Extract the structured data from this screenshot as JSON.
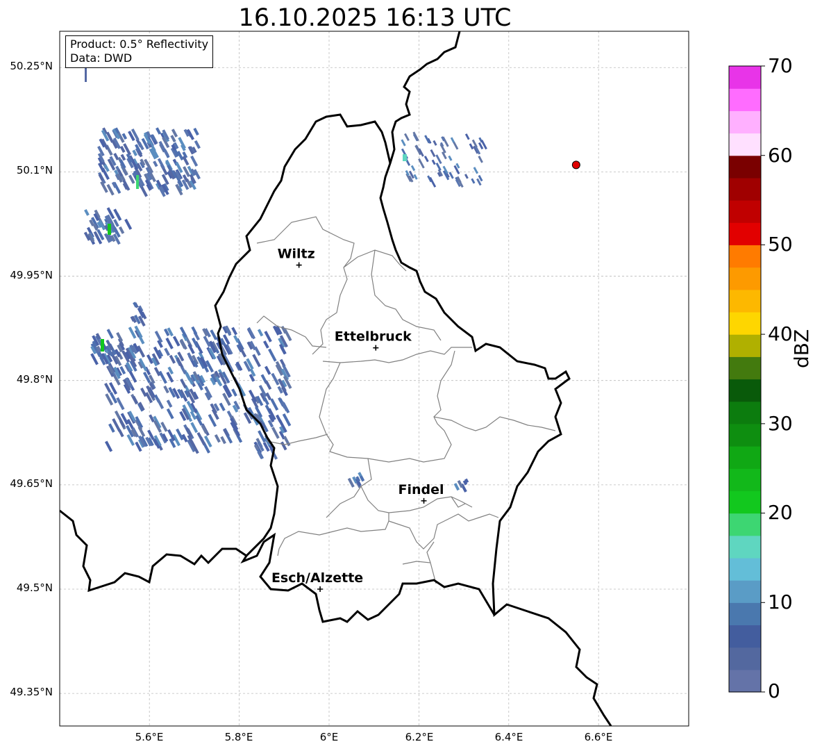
{
  "title": "16.10.2025 16:13 UTC",
  "info_box": {
    "product": "Product: 0.5° Reflectivity",
    "data": "Data: DWD"
  },
  "map": {
    "lat_ticks": [
      "50.25°N",
      "50.1°N",
      "49.95°N",
      "49.8°N",
      "49.65°N",
      "49.5°N",
      "49.35°N"
    ],
    "lon_ticks": [
      "5.6°E",
      "5.8°E",
      "6°E",
      "6.2°E",
      "6.4°E",
      "6.6°E"
    ],
    "cities": [
      {
        "name": "Wiltz",
        "lon": 5.933,
        "lat": 49.966
      },
      {
        "name": "Ettelbruck",
        "lon": 6.104,
        "lat": 49.847
      },
      {
        "name": "Findel",
        "lon": 6.211,
        "lat": 49.627
      },
      {
        "name": "Esch/Alzette",
        "lon": 5.98,
        "lat": 49.5
      }
    ],
    "marker": {
      "lon": 6.55,
      "lat": 50.11,
      "color": "#e00000"
    },
    "colors": {
      "border": "#000000",
      "districts": "#808080",
      "grid": "#bbbbbb"
    }
  },
  "colorbar": {
    "label": "dBZ",
    "ticks": [
      "0",
      "10",
      "20",
      "30",
      "40",
      "50",
      "60",
      "70"
    ],
    "range": [
      0,
      70
    ],
    "colors": [
      "#6473a8",
      "#53689f",
      "#435d9e",
      "#4a78ae",
      "#5a9cc6",
      "#63bed8",
      "#5fd6c0",
      "#3dd672",
      "#12c81e",
      "#12b81a",
      "#10a814",
      "#0e8e10",
      "#0c7c0e",
      "#095a0a",
      "#437a0e",
      "#b0b000",
      "#fed600",
      "#fdb800",
      "#fd9a00",
      "#ff7b00",
      "#e20000",
      "#c00000",
      "#a00000",
      "#7a0000",
      "#ffe0ff",
      "#ffb0ff",
      "#ff6cff",
      "#e834e8"
    ]
  }
}
